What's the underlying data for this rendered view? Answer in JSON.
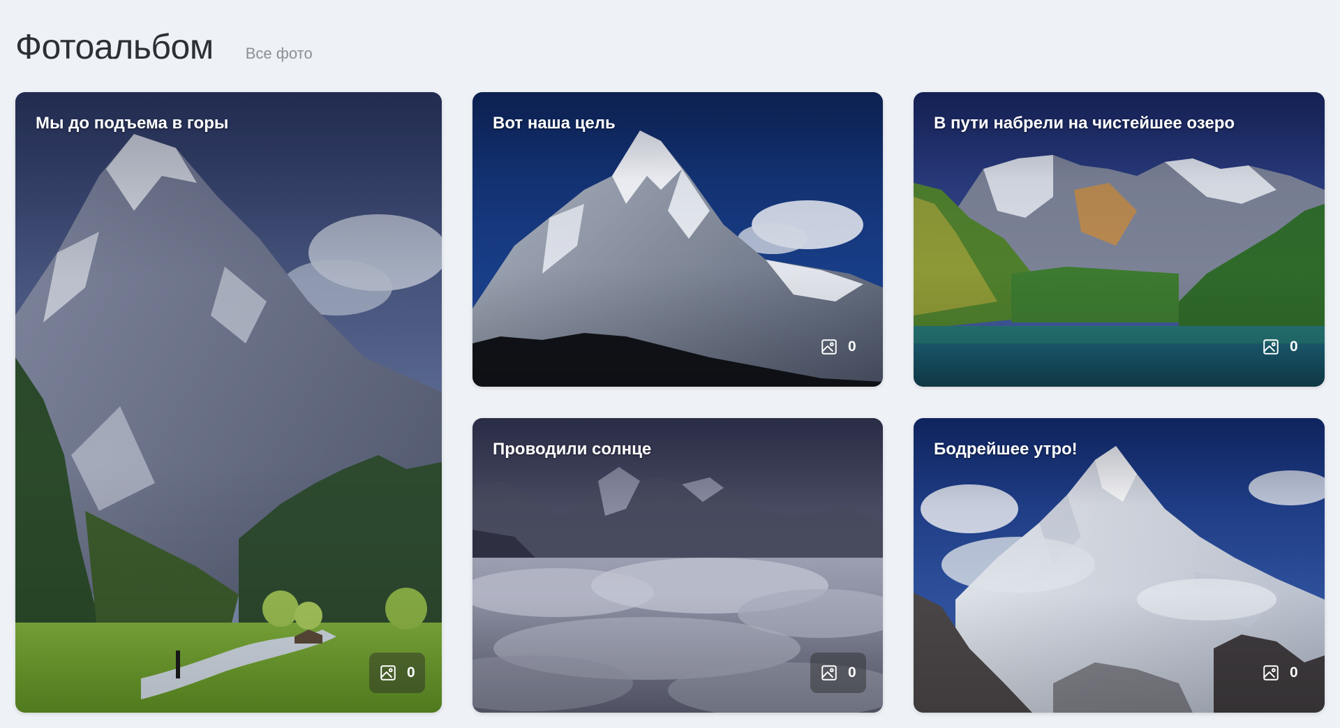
{
  "header": {
    "title": "Фотоальбом",
    "all_photos_link": "Все фото"
  },
  "albums": [
    {
      "title": "Мы до подъема в горы",
      "count": "0",
      "icon": "image-icon"
    },
    {
      "title": "Вот наша цель",
      "count": "0",
      "icon": "image-icon"
    },
    {
      "title": "В пути набрели на чистейшее озеро",
      "count": "0",
      "icon": "image-icon"
    },
    {
      "title": "Проводили солнце",
      "count": "0",
      "icon": "image-icon"
    },
    {
      "title": "Бодрейшее утро!",
      "count": "0",
      "icon": "image-icon"
    }
  ]
}
